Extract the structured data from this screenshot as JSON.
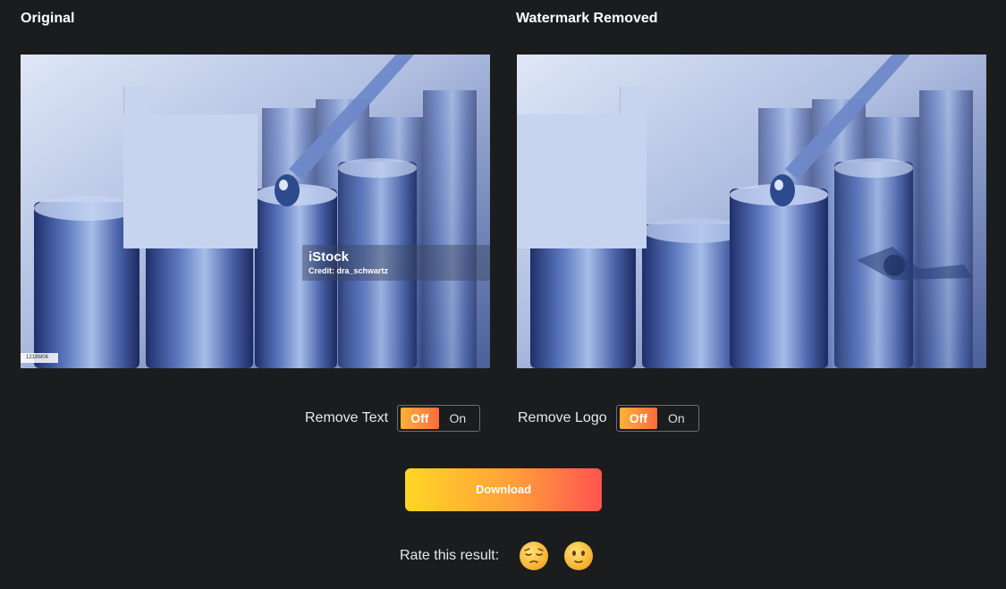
{
  "panels": {
    "original_title": "Original",
    "removed_title": "Watermark Removed"
  },
  "watermark": {
    "logo_text": "iStock",
    "credit_text": "Credit: dra_schwartz",
    "id_text": "1218M06"
  },
  "toggles": {
    "remove_text": {
      "label": "Remove Text",
      "off": "Off",
      "on": "On",
      "state": "Off"
    },
    "remove_logo": {
      "label": "Remove Logo",
      "off": "Off",
      "on": "On",
      "state": "Off"
    }
  },
  "actions": {
    "download_label": "Download"
  },
  "rating": {
    "label": "Rate this result:",
    "options": [
      "relieved-face-icon",
      "neutral-smile-face-icon"
    ]
  },
  "colors": {
    "background": "#1b1c1e",
    "accent_start": "#ffd626",
    "accent_end": "#ff5450"
  }
}
